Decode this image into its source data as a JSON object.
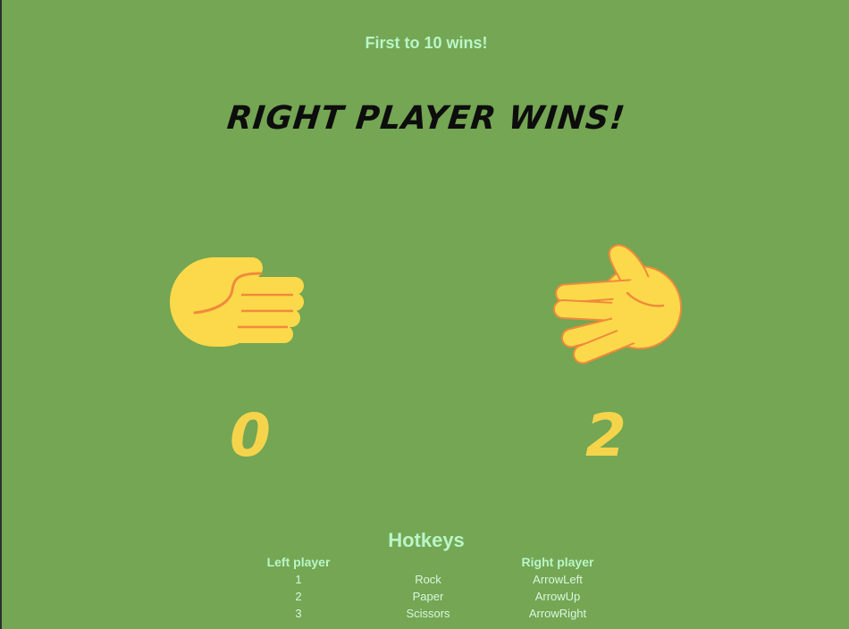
{
  "header": {
    "subtitle": "First to 10 wins!",
    "result": "RIGHT PLAYER WINS!"
  },
  "players": {
    "left": {
      "score": "0",
      "hand_icon": "rock-fist-icon"
    },
    "right": {
      "score": "2",
      "hand_icon": "paper-open-hand-icon"
    }
  },
  "hotkeys": {
    "title": "Hotkeys",
    "headers": {
      "left": "Left player",
      "middle": "",
      "right": "Right player"
    },
    "rows": [
      {
        "left": "1",
        "move": "Rock",
        "right": "ArrowLeft"
      },
      {
        "left": "2",
        "move": "Paper",
        "right": "ArrowUp"
      },
      {
        "left": "3",
        "move": "Scissors",
        "right": "ArrowRight"
      }
    ]
  },
  "colors": {
    "background": "#74a653",
    "accent_text": "#b9f5c8",
    "score": "#f5d44b",
    "hand_fill": "#fcd94a",
    "hand_line": "#f08a3c"
  }
}
